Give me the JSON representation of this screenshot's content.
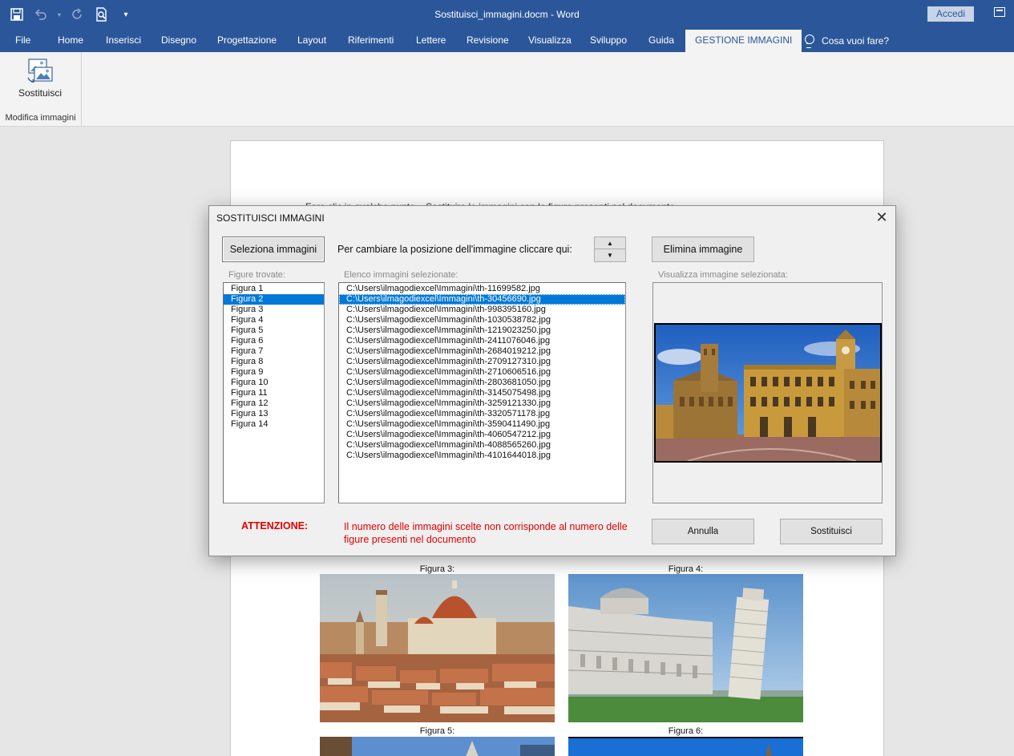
{
  "app": {
    "window_title": "Sostituisci_immagini.docm  -  Word",
    "signin_label": "Accedi"
  },
  "tabs": [
    {
      "label": "File"
    },
    {
      "label": "Home"
    },
    {
      "label": "Inserisci"
    },
    {
      "label": "Disegno"
    },
    {
      "label": "Progettazione"
    },
    {
      "label": "Layout"
    },
    {
      "label": "Riferimenti"
    },
    {
      "label": "Lettere"
    },
    {
      "label": "Revisione"
    },
    {
      "label": "Visualizza"
    },
    {
      "label": "Sviluppo"
    },
    {
      "label": "Guida"
    },
    {
      "label": "GESTIONE IMMAGINI"
    }
  ],
  "tellme": {
    "label": "Cosa vuoi fare?"
  },
  "ribbon": {
    "button_label": "Sostituisci",
    "group_label": "Modifica immagini"
  },
  "document": {
    "text_line": "Fare clic in qualche punto... Sostituire le immagini con le figure presenti nel documento",
    "captions": [
      "Figura 3:",
      "Figura 4:",
      "Figura 5:",
      "Figura 6:"
    ]
  },
  "dialog": {
    "title": "SOSTITUISCI IMMAGINI",
    "select_button": "Seleziona immagini",
    "position_hint": "Per cambiare la posizione dell'immagine cliccare qui:",
    "delete_button": "Elimina immagine",
    "figures_label": "Figure trovate:",
    "images_label": "Elenco immagini selezionate:",
    "preview_label": "Visualizza immagine selezionata:",
    "figures": [
      "Figura 1",
      "Figura 2",
      "Figura 3",
      "Figura 4",
      "Figura 5",
      "Figura 6",
      "Figura 7",
      "Figura 8",
      "Figura 9",
      "Figura 10",
      "Figura 11",
      "Figura 12",
      "Figura 13",
      "Figura 14"
    ],
    "selected_figure_index": 1,
    "images": [
      "C:\\Users\\ilmagodiexcel\\Immagini\\th-11699582.jpg",
      "C:\\Users\\ilmagodiexcel\\Immagini\\th-30456690.jpg",
      "C:\\Users\\ilmagodiexcel\\Immagini\\th-998395160.jpg",
      "C:\\Users\\ilmagodiexcel\\Immagini\\th-1030538782.jpg",
      "C:\\Users\\ilmagodiexcel\\Immagini\\th-1219023250.jpg",
      "C:\\Users\\ilmagodiexcel\\Immagini\\th-2411076046.jpg",
      "C:\\Users\\ilmagodiexcel\\Immagini\\th-2684019212.jpg",
      "C:\\Users\\ilmagodiexcel\\Immagini\\th-2709127310.jpg",
      "C:\\Users\\ilmagodiexcel\\Immagini\\th-2710606516.jpg",
      "C:\\Users\\ilmagodiexcel\\Immagini\\th-2803681050.jpg",
      "C:\\Users\\ilmagodiexcel\\Immagini\\th-3145075498.jpg",
      "C:\\Users\\ilmagodiexcel\\Immagini\\th-3259121330.jpg",
      "C:\\Users\\ilmagodiexcel\\Immagini\\th-3320571178.jpg",
      "C:\\Users\\ilmagodiexcel\\Immagini\\th-3590411490.jpg",
      "C:\\Users\\ilmagodiexcel\\Immagini\\th-4060547212.jpg",
      "C:\\Users\\ilmagodiexcel\\Immagini\\th-4088565260.jpg",
      "C:\\Users\\ilmagodiexcel\\Immagini\\th-4101644018.jpg"
    ],
    "selected_image_index": 1,
    "warning_title": "ATTENZIONE:",
    "warning_text": "Il numero delle immagini scelte non corrisponde al numero delle figure presenti nel documento",
    "cancel_button": "Annulla",
    "replace_button": "Sostituisci"
  },
  "colors": {
    "word_blue": "#2b579a",
    "selection_blue": "#0078d7",
    "warning_red": "#e00000"
  }
}
